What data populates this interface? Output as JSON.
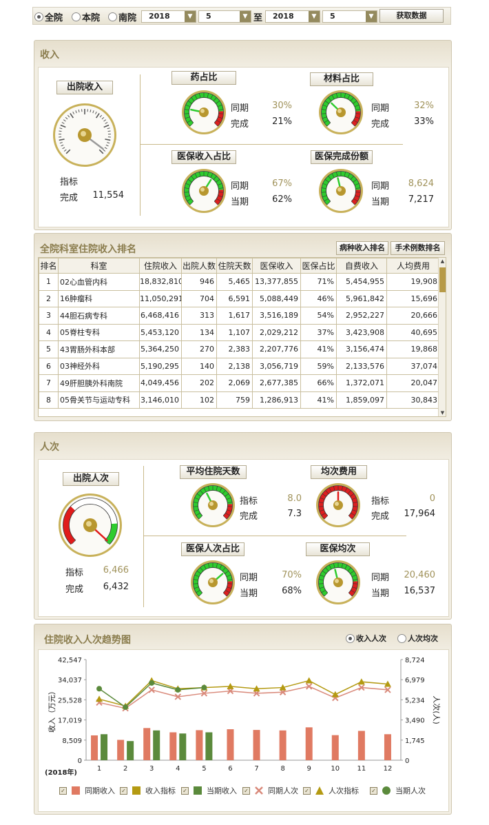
{
  "filter": {
    "scope_options": [
      {
        "label": "全院",
        "selected": true
      },
      {
        "label": "本院",
        "selected": false
      },
      {
        "label": "南院",
        "selected": false
      }
    ],
    "from_year": "2018",
    "from_month": "5",
    "to_label": "至",
    "to_year": "2018",
    "to_month": "5",
    "fetch_label": "获取数据"
  },
  "income": {
    "title": "收入",
    "discharge": {
      "label": "出院收入",
      "target_label": "指标",
      "target_value": "",
      "done_label": "完成",
      "done_value": "11,554"
    },
    "drug": {
      "label": "药占比",
      "l1": "同期",
      "v1": "30%",
      "l2": "完成",
      "v2": "21%",
      "level": 0.21
    },
    "material": {
      "label": "材料占比",
      "l1": "同期",
      "v1": "32%",
      "l2": "完成",
      "v2": "33%",
      "level": 0.33
    },
    "insurance_ratio": {
      "label": "医保收入占比",
      "l1": "同期",
      "v1": "67%",
      "l2": "当期",
      "v2": "62%",
      "level": 0.62
    },
    "insurance_quota": {
      "label": "医保完成份额",
      "l1": "同期",
      "v1": "8,624",
      "l2": "当期",
      "v2": "7,217",
      "level": 0.45
    }
  },
  "ranking": {
    "title": "全院科室住院收入排名",
    "btn_disease": "病种收入排名",
    "btn_surgery": "手术例数排名",
    "columns": [
      "排名",
      "科室",
      "住院收入",
      "出院人数",
      "住院天数",
      "医保收入",
      "医保占比",
      "自费收入",
      "人均费用"
    ],
    "rows": [
      [
        "1",
        "02心血管内科",
        "18,832,810",
        "946",
        "5,465",
        "13,377,855",
        "71%",
        "5,454,955",
        "19,908"
      ],
      [
        "2",
        "16肿瘤科",
        "11,050,291",
        "704",
        "6,591",
        "5,088,449",
        "46%",
        "5,961,842",
        "15,696"
      ],
      [
        "3",
        "44胆石病专科",
        "6,468,416",
        "313",
        "1,617",
        "3,516,189",
        "54%",
        "2,952,227",
        "20,666"
      ],
      [
        "4",
        "05脊柱专科",
        "5,453,120",
        "134",
        "1,107",
        "2,029,212",
        "37%",
        "3,423,908",
        "40,695"
      ],
      [
        "5",
        "43胃肠外科本部",
        "5,364,250",
        "270",
        "2,383",
        "2,207,776",
        "41%",
        "3,156,474",
        "19,868"
      ],
      [
        "6",
        "03神经外科",
        "5,190,295",
        "140",
        "2,138",
        "3,056,719",
        "59%",
        "2,133,576",
        "37,074"
      ],
      [
        "7",
        "49肝胆胰外科南院",
        "4,049,456",
        "202",
        "2,069",
        "2,677,385",
        "66%",
        "1,372,071",
        "20,047"
      ],
      [
        "8",
        "05骨关节与运动专科",
        "3,146,010",
        "102",
        "759",
        "1,286,913",
        "41%",
        "1,859,097",
        "30,843"
      ]
    ]
  },
  "visits": {
    "title": "人次",
    "discharge": {
      "label": "出院人次",
      "target_label": "指标",
      "target_value": "6,466",
      "done_label": "完成",
      "done_value": "6,432",
      "level": 0.99
    },
    "avg_days": {
      "label": "平均住院天数",
      "l1": "指标",
      "v1": "8.0",
      "l2": "完成",
      "v2": "7.3",
      "level": 0.4
    },
    "avg_cost": {
      "label": "均次费用",
      "l1": "指标",
      "v1": "0",
      "l2": "完成",
      "v2": "17,964",
      "level": 0.5
    },
    "insurance_ratio": {
      "label": "医保人次占比",
      "l1": "同期",
      "v1": "70%",
      "l2": "当期",
      "v2": "68%",
      "level": 0.68
    },
    "insurance_avg": {
      "label": "医保均次",
      "l1": "同期",
      "v1": "20,460",
      "l2": "当期",
      "v2": "16,537",
      "level": 0.45
    }
  },
  "trend": {
    "title": "住院收入人次趋势图",
    "mode_options": [
      {
        "label": "收入人次",
        "selected": true
      },
      {
        "label": "人次均次",
        "selected": false
      }
    ]
  },
  "colors": {
    "gold": "#8b7d4e",
    "bar_prev": "#e07a62",
    "bar_cur": "#5b8a3c",
    "line_target": "#b49a12",
    "line_prev": "#d9897a"
  },
  "chart_data": {
    "type": "bar",
    "title": "",
    "year_label": "(2018年)",
    "x": [
      "1",
      "2",
      "3",
      "4",
      "5",
      "6",
      "7",
      "8",
      "9",
      "10",
      "11",
      "12"
    ],
    "ylabel": "收入（万元）",
    "ylabel_right": "人次(人)",
    "ylim": [
      0,
      42547
    ],
    "yticks": [
      "42,547",
      "34,037",
      "25,528",
      "17,019",
      "8,509",
      "0"
    ],
    "ylim_right": [
      0,
      8724
    ],
    "yticks_right": [
      "8,724",
      "6,979",
      "5,234",
      "3,490",
      "1,745",
      "0"
    ],
    "series": [
      {
        "name": "同期收入",
        "kind": "bar",
        "values": [
          10500,
          8600,
          13600,
          11800,
          12700,
          13100,
          12800,
          12600,
          13900,
          10600,
          12400,
          11000
        ]
      },
      {
        "name": "收入指标",
        "kind": "line",
        "values": null
      },
      {
        "name": "当期收入",
        "kind": "bar",
        "values": [
          11000,
          8100,
          12600,
          11300,
          11800,
          null,
          null,
          null,
          null,
          null,
          null,
          null
        ]
      },
      {
        "name": "同期人次",
        "kind": "line-right",
        "values": [
          5000,
          4500,
          6100,
          5500,
          5800,
          6000,
          5800,
          5900,
          6400,
          5400,
          6300,
          6100
        ]
      },
      {
        "name": "人次指标",
        "kind": "line-right",
        "values": [
          5300,
          4700,
          6900,
          6200,
          6300,
          6400,
          6200,
          6300,
          6900,
          5700,
          6800,
          6600
        ]
      },
      {
        "name": "当期人次",
        "kind": "line-right",
        "values": [
          6200,
          4600,
          6700,
          6100,
          6300,
          null,
          null,
          null,
          null,
          null,
          null,
          null
        ]
      }
    ]
  }
}
